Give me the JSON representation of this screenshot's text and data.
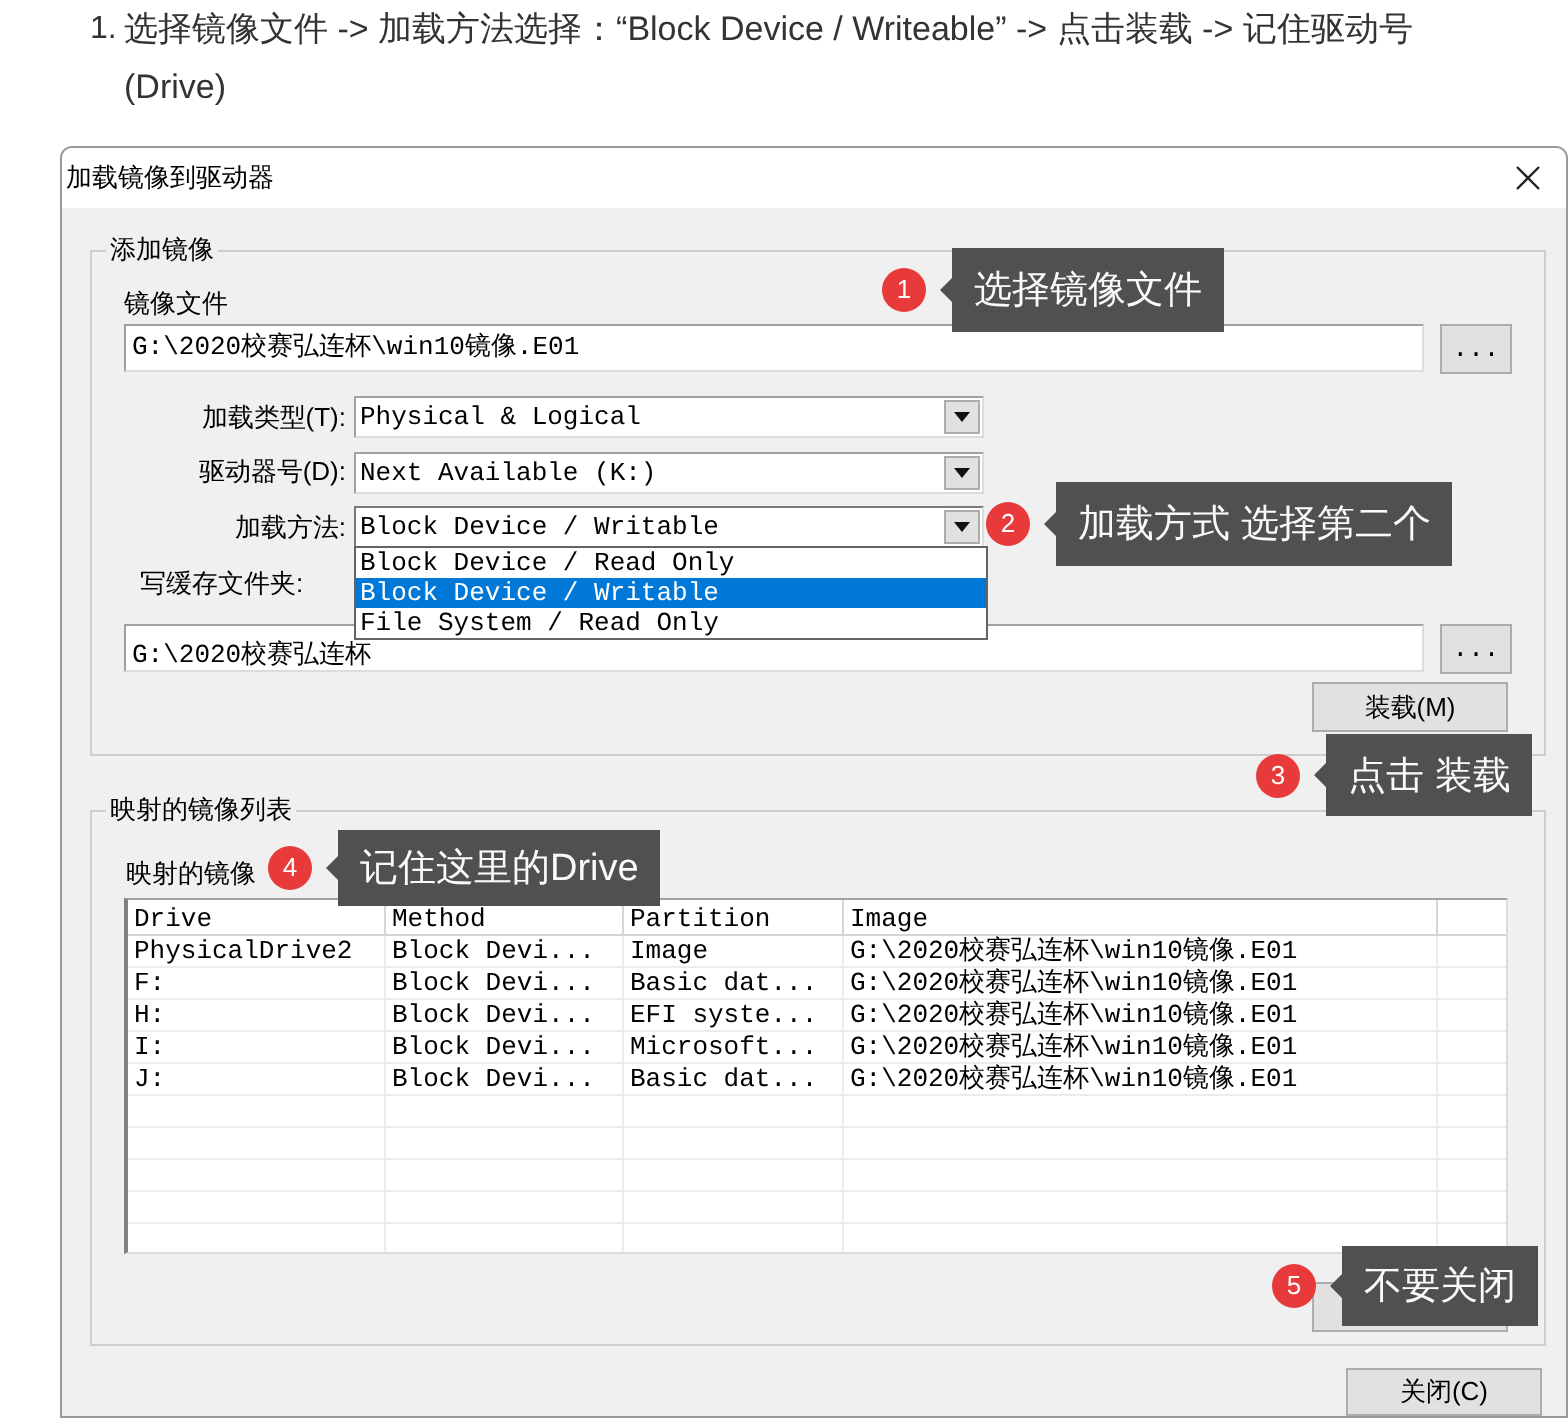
{
  "instruction": {
    "number": "1.",
    "text": "选择镜像文件 -> 加载方法选择：“Block Device / Writeable” -> 点击装载 -> 记住驱动号(Drive)"
  },
  "dialog": {
    "title": "加载镜像到驱动器",
    "add_group": {
      "title": "添加镜像",
      "image_file": {
        "label": "镜像文件",
        "value": "G:\\2020校赛弘连杯\\win10镜像.E01",
        "browse": "..."
      },
      "combos": [
        {
          "label": "加载类型(T):",
          "value": "Physical & Logical",
          "expanded": false
        },
        {
          "label": "驱动器号(D):",
          "value": "Next Available (K:)",
          "expanded": false
        },
        {
          "label": "加载方法:",
          "value": "Block Device / Writable",
          "expanded": true,
          "options": [
            {
              "label": "Block Device / Read Only",
              "selected": false
            },
            {
              "label": "Block Device / Writable",
              "selected": true
            },
            {
              "label": "File System / Read Only",
              "selected": false
            }
          ]
        }
      ],
      "cache_folder": {
        "label": "写缓存文件夹:",
        "value": "G:\\2020校赛弘连杯",
        "browse": "..."
      },
      "mount_button": "装载(M)"
    },
    "mapped_group": {
      "title": "映射的镜像列表",
      "list_label": "映射的镜像",
      "table": {
        "columns": [
          "Drive",
          "Method",
          "Partition",
          "Image"
        ],
        "rows": [
          [
            "PhysicalDrive2",
            "Block Devi...",
            "Image",
            "G:\\2020校赛弘连杯\\win10镜像.E01"
          ],
          [
            "F:",
            "Block Devi...",
            "Basic dat...",
            "G:\\2020校赛弘连杯\\win10镜像.E01"
          ],
          [
            "H:",
            "Block Devi...",
            "EFI syste...",
            "G:\\2020校赛弘连杯\\win10镜像.E01"
          ],
          [
            "I:",
            "Block Devi...",
            "Microsoft...",
            "G:\\2020校赛弘连杯\\win10镜像.E01"
          ],
          [
            "J:",
            "Block Devi...",
            "Basic dat...",
            "G:\\2020校赛弘连杯\\win10镜像.E01"
          ]
        ]
      }
    },
    "close_button": "关闭(C)"
  },
  "annotations": [
    {
      "number": "1",
      "text": "选择镜像文件"
    },
    {
      "number": "2",
      "text": "加载方式 选择第二个"
    },
    {
      "number": "3",
      "text": "点击 装载"
    },
    {
      "number": "4",
      "text": "记住这里的Drive"
    },
    {
      "number": "5",
      "text": "不要关闭"
    }
  ]
}
